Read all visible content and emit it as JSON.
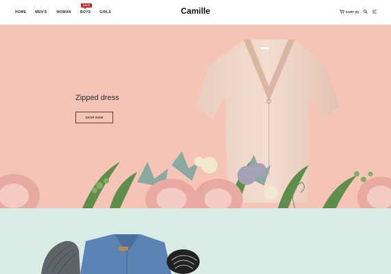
{
  "brand": {
    "name": "Camille"
  },
  "nav": {
    "items": [
      {
        "label": "HOME"
      },
      {
        "label": "MEN'S"
      },
      {
        "label": "WOMAN"
      },
      {
        "label": "BOYS",
        "badge": "SALE"
      },
      {
        "label": "GIRLS"
      }
    ]
  },
  "header": {
    "cart_label": "CART (0)",
    "icons": [
      "cart-icon",
      "search-icon",
      "menu-icon"
    ]
  },
  "hero": {
    "title": "Zipped dress",
    "button_label": "SHOP NOW",
    "background_color": "#f6c4b6"
  },
  "lower": {
    "background_color": "#d9ebe5"
  },
  "colors": {
    "badge": "#d0202a",
    "text": "#222222"
  }
}
